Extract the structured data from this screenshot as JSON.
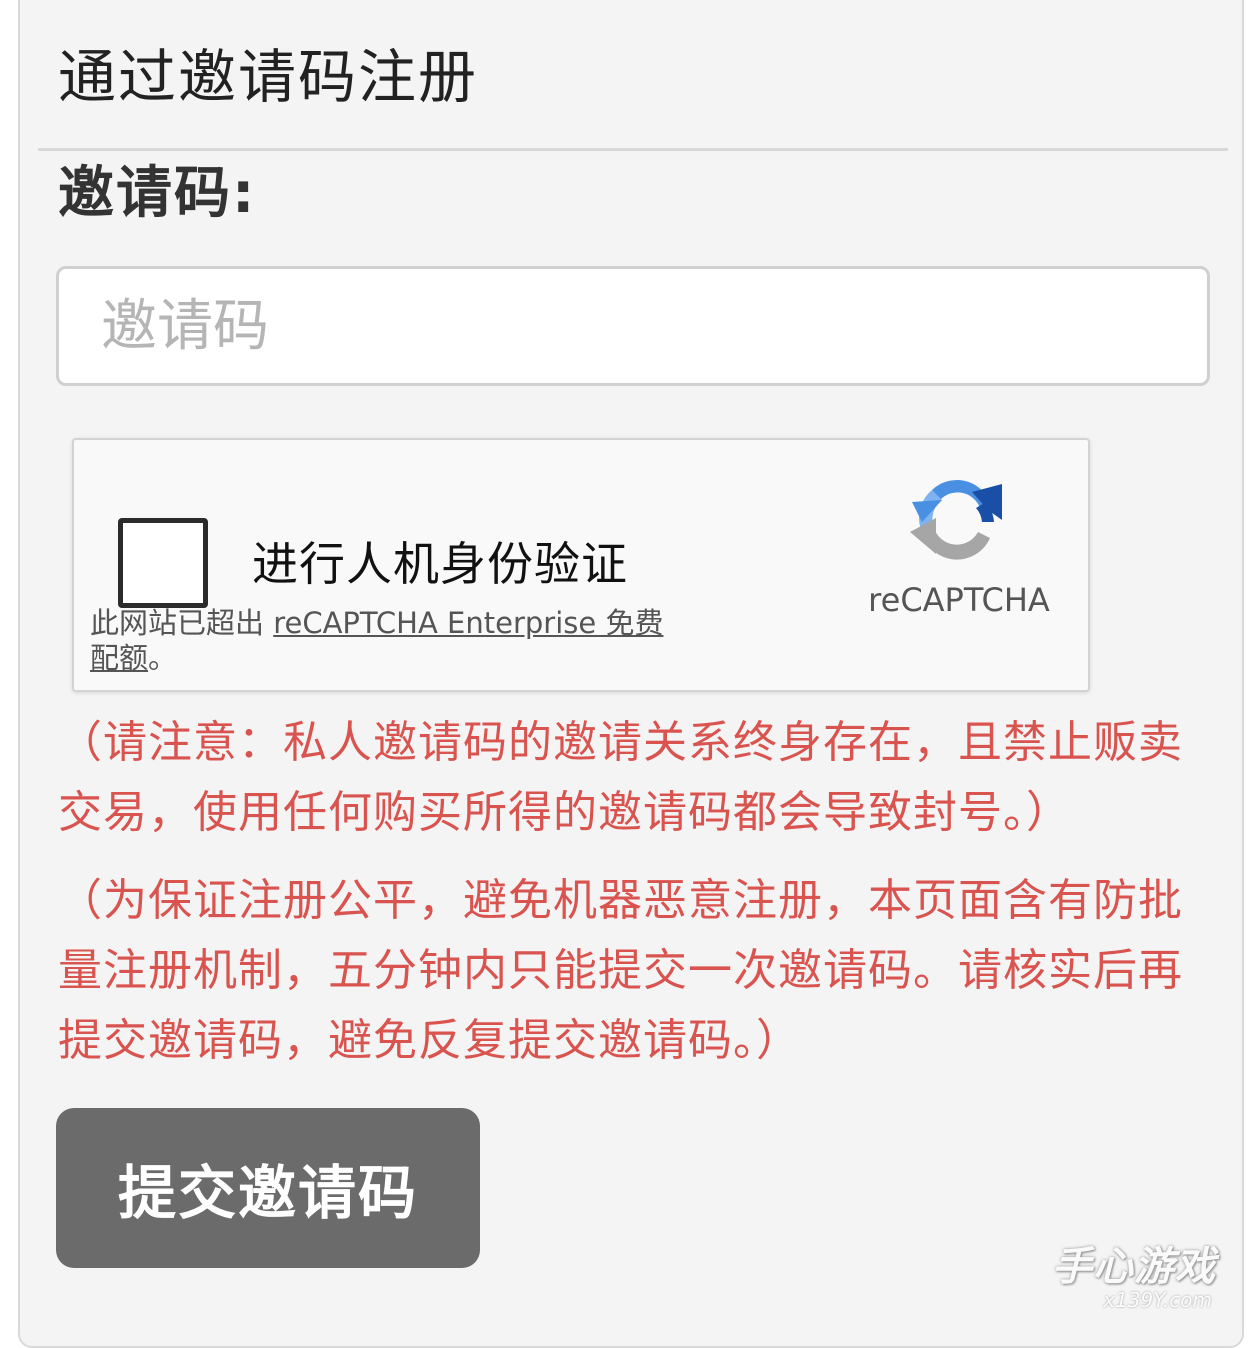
{
  "header": {
    "title": "通过邀请码注册"
  },
  "form": {
    "invite_label": "邀请码:",
    "invite_placeholder": "邀请码",
    "invite_value": "",
    "submit_label": "提交邀请码"
  },
  "captcha": {
    "checkbox_label": "进行人机身份验证",
    "notice_prefix": "此网站已超出 ",
    "notice_link": "reCAPTCHA Enterprise 免费配额",
    "notice_suffix": "。",
    "brand": "reCAPTCHA",
    "logo_icon": "recaptcha-logo-icon",
    "checked": false
  },
  "notices": [
    "（请注意：私人邀请码的邀请关系终身存在，且禁止贩卖交易，使用任何购买所得的邀请码都会导致封号。）",
    "（为保证注册公平，避免机器恶意注册，本页面含有防批量注册机制，五分钟内只能提交一次邀请码。请核实后再提交邀请码，避免反复提交邀请码。）"
  ],
  "watermark": {
    "text": "手心游戏",
    "sub": "x139Y.com"
  },
  "colors": {
    "notice": "#d9534f",
    "button": "#6b6b6b",
    "panel": "#f4f4f4"
  }
}
